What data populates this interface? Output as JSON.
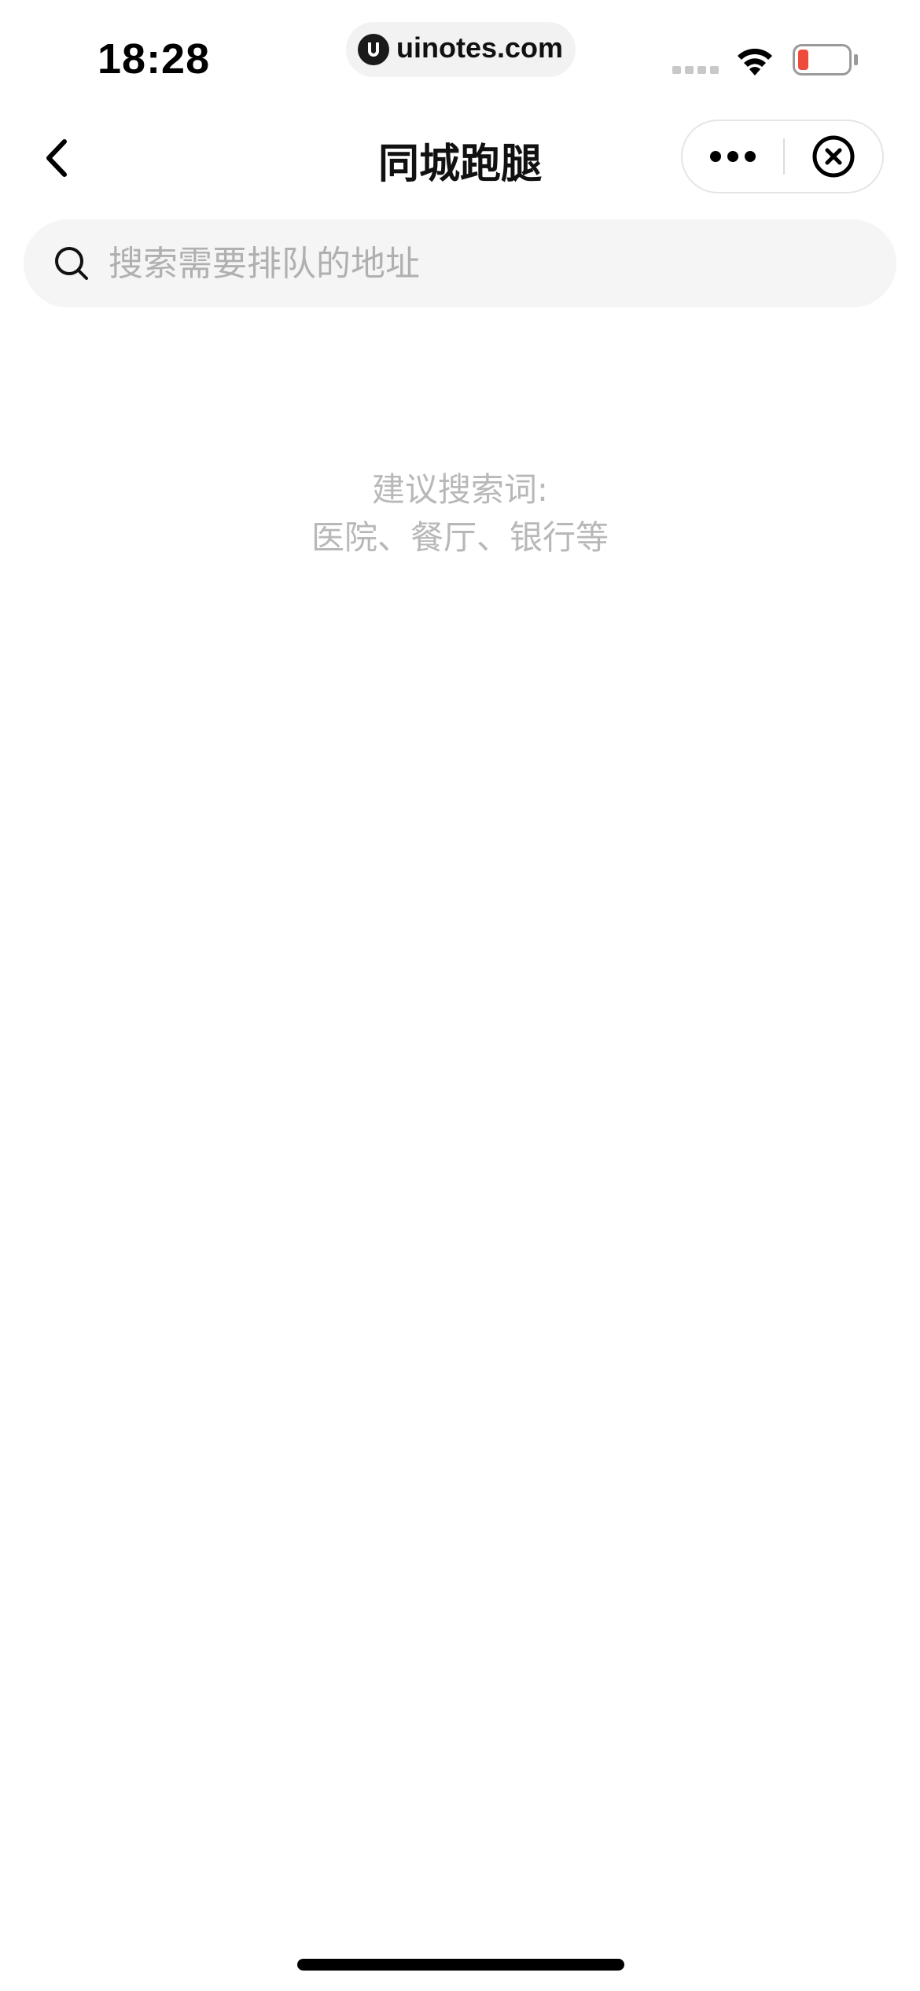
{
  "status_bar": {
    "time": "18:28",
    "url": "uinotes.com",
    "battery_color": "#ef4b3c"
  },
  "nav": {
    "title": "同城跑腿",
    "back_icon": "chevron-left-icon",
    "more_icon": "more-dots-icon",
    "close_icon": "close-circle-icon"
  },
  "search": {
    "placeholder": "搜索需要排队的地址",
    "value": ""
  },
  "suggestion": {
    "heading": "建议搜索词:",
    "examples": "医院、餐厅、银行等"
  }
}
